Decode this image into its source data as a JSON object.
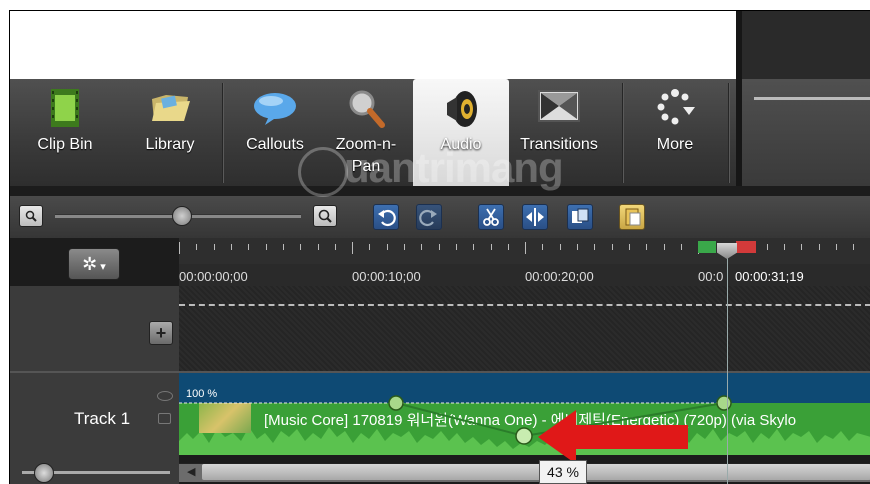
{
  "toolbar": {
    "tabs": [
      {
        "label": "Clip Bin",
        "icon": "film-strip-icon"
      },
      {
        "label": "Library",
        "icon": "folder-open-icon"
      },
      {
        "label": "Callouts",
        "icon": "speech-bubble-icon"
      },
      {
        "label": "Zoom-n-\nPan",
        "icon": "magnifier-icon"
      },
      {
        "label": "Audio",
        "icon": "speaker-icon",
        "selected": true
      },
      {
        "label": "Transitions",
        "icon": "transition-icon"
      },
      {
        "label": "More",
        "icon": "more-dots-icon"
      }
    ]
  },
  "watermark": "uantrimang",
  "timeline": {
    "ruler_labels": [
      "00:00:00;00",
      "00:00:10;00",
      "00:00:20;00",
      "00:0"
    ],
    "playhead_time": "00:00:31;19",
    "track_name": "Track 1",
    "clip": {
      "volume_label": "100 %",
      "title": "[Music Core] 170819 워너원(Wanna One) - 에너제틱(Energetic) (720p) (via Skylo"
    },
    "tooltip": "43 %"
  },
  "colors": {
    "clip_green": "#3aa037",
    "clip_blue": "#0e4a74",
    "arrow_red": "#e01818"
  }
}
